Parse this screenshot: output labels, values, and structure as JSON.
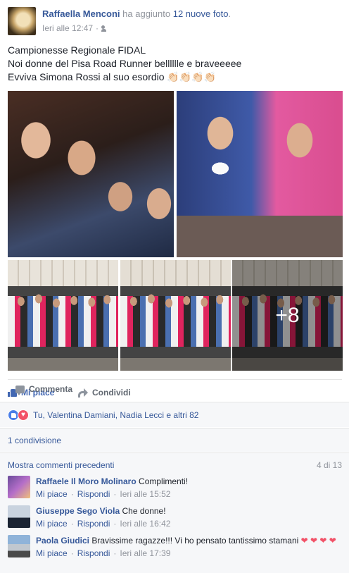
{
  "post": {
    "author": "Raffaella Menconi",
    "action_text": "ha aggiunto",
    "action_link": "12 nuove foto",
    "action_end": ".",
    "timestamp": "Ieri alle 12:47",
    "separator": "·",
    "audience_icon": "friends-icon",
    "text_lines": [
      "Campionesse Regionale FIDAL",
      "Noi donne del Pisa Road Runner belllllle e braveeeee",
      "Evviva Simona Rossi al suo esordio 👏🏻👏🏻👏🏻👏🏻"
    ],
    "more_photos": "+8"
  },
  "actions": {
    "like": "Mi piace",
    "comment": "Commenta",
    "share": "Condividi"
  },
  "reactions": {
    "icons": [
      "like-icon",
      "love-icon"
    ],
    "text": "Tu, Valentina Damiani, Nadia Lecci e altri 82"
  },
  "shares": {
    "text": "1 condivisione"
  },
  "comments_header": {
    "more": "Mostra commenti precedenti",
    "count": "4 di 13"
  },
  "comments": [
    {
      "author": "Raffaele Il Moro Molinaro",
      "text": "Complimenti!",
      "like": "Mi piace",
      "reply": "Rispondi",
      "time": "Ieri alle 15:52",
      "dot": "·"
    },
    {
      "author": "Giuseppe Sego Viola",
      "text": "Che donne!",
      "like": "Mi piace",
      "reply": "Rispondi",
      "time": "Ieri alle 16:42",
      "dot": "·"
    },
    {
      "author": "Paola Giudici",
      "text": "Bravissime ragazze!!! Vi ho pensato tantissimo stamani",
      "hearts": "❤ ❤ ❤ ❤",
      "like": "Mi piace",
      "reply": "Rispondi",
      "time": "Ieri alle 17:39",
      "dot": "·"
    }
  ],
  "colors": {
    "link": "#365899",
    "muted": "#90949c",
    "like_blue": "#4267b2",
    "love_red": "#f25268"
  }
}
